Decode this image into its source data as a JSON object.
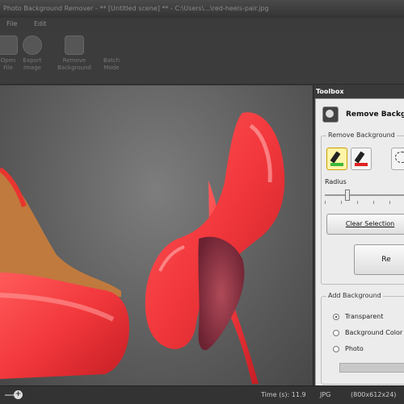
{
  "window": {
    "title": "Photo Background Remover - ** [Untitled scene] ** - C:\\Users\\...\\red-heels-pair.jpg"
  },
  "menu": {
    "items": [
      "File",
      "Edit"
    ]
  },
  "ribbon": {
    "buttons": [
      {
        "label": "Open\nFile",
        "icon": "folder-icon"
      },
      {
        "label": "Export\nImage",
        "icon": "gear-icon"
      },
      {
        "label": "Remove\nBackground",
        "icon": "add-icon"
      },
      {
        "label": "Batch\nMode",
        "icon": "tools-icon"
      }
    ]
  },
  "toolbox": {
    "header": "Toolbox",
    "title": "Remove Backg",
    "remove_group": {
      "label": "Remove Background",
      "radius_label": "Radius",
      "radius_value": 0.25,
      "clear_selection": "Clear Selection",
      "remove_button": "Re"
    },
    "add_group": {
      "label": "Add Background",
      "options": [
        "Transparent",
        "Background Color",
        "Photo"
      ],
      "selected": "Transparent"
    }
  },
  "status": {
    "time": "Time (s): 11.9",
    "format": "JPG",
    "size": "(800x612x24)"
  },
  "colors": {
    "shoe_red": "#f2383c",
    "keep_marker": "#3bb93b",
    "remove_marker": "#e02020",
    "panel_bg": "#ececec"
  }
}
